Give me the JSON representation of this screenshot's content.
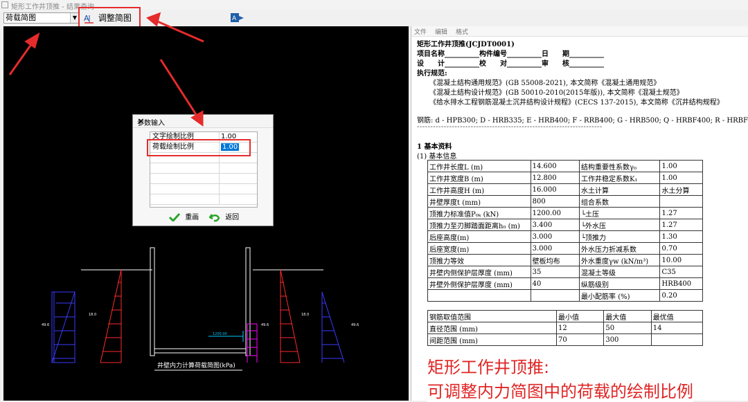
{
  "window": {
    "title": "矩形工作井顶推 - 结果查询"
  },
  "toolbar": {
    "combo_value": "荷载简图",
    "adjust_label": "调整简图"
  },
  "dialog": {
    "title": "参数输入",
    "close": "✕",
    "rows": [
      {
        "name": "文字绘制比例",
        "value": "1.00"
      },
      {
        "name": "荷载绘制比例",
        "value": "1.00"
      }
    ],
    "redraw": "重画",
    "back": "返回"
  },
  "drawing": {
    "caption": "井壁内力计算荷载简图(kPa)",
    "labels": {
      "left_outer": "49.6",
      "left_inner": "18.0",
      "right_inner": "18.0",
      "right_outer": "49.6",
      "mid": "49.6",
      "dim": "1200.00"
    }
  },
  "report": {
    "menu": [
      "文件",
      "编辑",
      "格式"
    ],
    "title": "矩形工作井顶推(JCJDT0001)",
    "line_project": "项目名称__________构件编号__________日　　期__________",
    "line_design": "设　　计__________校　　对__________审　　核__________",
    "exec_title": "执行规范:",
    "std1": "《混凝土结构通用规范》(GB 55008-2021), 本文简称《混凝土通用规范》",
    "std2": "《混凝土结构设计规范》(GB 50010-2010(2015年版)), 本文简称《混凝土规范》",
    "std3": "《给水排水工程钢筋混凝土沉井结构设计规程》(CECS 137-2015), 本文简称《沉井结构规程》",
    "rebar": "钢筋: d - HPB300; D - HRB335; E - HRB400; F - RRB400; G - HRB500; Q - HRBF400; R - HRBF500",
    "dashes": "---------------------------------------------------------------------",
    "sec1": "1  基本资料",
    "sec1_1": "(1) 基本信息",
    "table1": [
      [
        "工作井长度L (m)",
        "14.600",
        "结构重要性系数γ₀",
        "1.00"
      ],
      [
        "工作井宽度B (m)",
        "12.800",
        "工作井稳定系数K₁",
        "1.00"
      ],
      [
        "工作井高度H (m)",
        "16.000",
        "水土计算",
        "水土分算"
      ],
      [
        "井壁厚度t (mm)",
        "800",
        "组合系数",
        ""
      ],
      [
        "顶推力标准值P₀ₖ (kN)",
        "1200.00",
        " └土压",
        "1.27"
      ],
      [
        "顶推力至刃脚踏面距离h₀ (m)",
        "3.400",
        " └外水压",
        "1.27"
      ],
      [
        "后座高度(m)",
        "3.000",
        " └顶推力",
        "1.30"
      ],
      [
        "后座宽度(m)",
        "3.000",
        "外水压力折减系数",
        "0.70"
      ],
      [
        "顶推力等效",
        "壁板均布",
        "外水重度γw (kN/m³)",
        "10.00"
      ],
      [
        "井壁内侧保护层厚度 (mm)",
        "35",
        "混凝土等级",
        "C35"
      ],
      [
        "井壁外侧保护层厚度 (mm)",
        "40",
        "纵筋级别",
        "HRB400"
      ],
      [
        "",
        "",
        "最小配筋率 (%)",
        "0.20"
      ]
    ],
    "table2": [
      [
        "钢筋取值范围",
        "最小值",
        "最大值",
        "最优值"
      ],
      [
        "直径范围 (mm)",
        "12",
        "50",
        "14"
      ],
      [
        "间距范围 (mm)",
        "70",
        "300",
        ""
      ]
    ]
  },
  "overlay": {
    "line1": "矩形工作井顶推:",
    "line2": "可调整内力简图中的荷载的绘制比例"
  },
  "colors": {
    "annotation": "#e52b2b",
    "load_blue": "#3a3aff",
    "load_red": "#ff2a2a",
    "load_magenta": "#ff00ff",
    "dim_cyan": "#00c8ff"
  }
}
